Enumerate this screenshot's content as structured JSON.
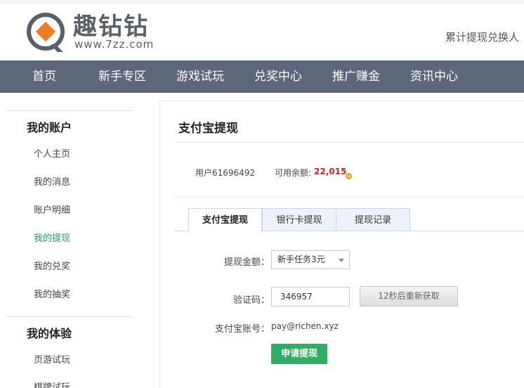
{
  "header": {
    "logo_title": "趣钻钻",
    "logo_url": "www.7zz.com",
    "right_text": "累计提现兑换人"
  },
  "nav": {
    "items": [
      "首页",
      "新手专区",
      "游戏试玩",
      "兑奖中心",
      "推广赚金",
      "资讯中心"
    ]
  },
  "sidebar": {
    "section1": {
      "title": "我的账户",
      "items": [
        "个人主页",
        "我的消息",
        "账户明细",
        "我的提现",
        "我的兑奖",
        "我的抽奖"
      ]
    },
    "section2": {
      "title": "我的体验",
      "items": [
        "页游试玩",
        "棋牌试玩"
      ]
    },
    "active_item": "我的提现"
  },
  "main": {
    "title": "支付宝提现",
    "user_label": "用户61696492",
    "balance_label": "可用余额:",
    "balance_value": "22,015",
    "tabs": [
      "支付宝提现",
      "银行卡提现",
      "提现记录"
    ],
    "active_tab": "支付宝提现",
    "form": {
      "amount_label": "提现金额：",
      "amount_selected": "新手任务3元",
      "code_label": "验证码：",
      "code_value": "346957",
      "resend_label": "12秒后重新获取",
      "account_label": "支付宝账号：",
      "account_value": "pay@richen.xyz",
      "submit_label": "申请提现"
    }
  },
  "colors": {
    "nav_bg": "#5c677a",
    "logo_orange": "#f07a1e",
    "logo_gray": "#5b6068",
    "active_green": "#2f9a5c",
    "submit_green": "#2fae62",
    "balance_red": "#e02020"
  },
  "icons": {
    "logo": "q-chat-bubble-logo",
    "balance": "coin-chevron-icon",
    "dropdown": "chevron-down-icon"
  }
}
